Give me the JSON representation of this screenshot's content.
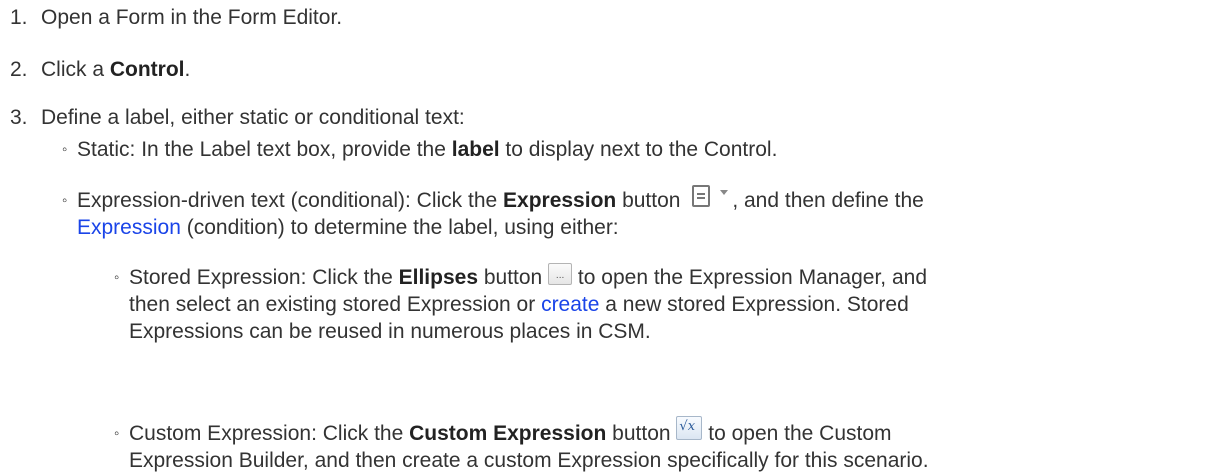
{
  "steps": [
    {
      "num": "1.",
      "text": "Open a Form in the Form Editor."
    },
    {
      "num": "2.",
      "pre": "Click a ",
      "bold": "Control",
      "post": "."
    },
    {
      "num": "3.",
      "text": "Define a label, either static or conditional text:"
    }
  ],
  "static_item": {
    "pre": "Static: In the Label text box, provide the ",
    "bold": "label",
    "post": " to display next to the Control."
  },
  "expression_item": {
    "pre": "Expression-driven text (conditional): Click the ",
    "bold": "Expression",
    "mid": " button",
    "post": ", and then define the",
    "link": "Expression",
    "post2": " (condition) to determine the label, using either:",
    "icon": "expression-document-dropdown-icon"
  },
  "stored_item": {
    "pre": "Stored Expression: Click the ",
    "bold": "Ellipses",
    "mid": " button",
    "post": " to open the Expression Manager, and",
    "line2_pre": "then select an existing stored Expression or ",
    "link": "create",
    "line2_post": " a new stored Expression. Stored",
    "line3": "Expressions can be reused in numerous places in CSM.",
    "icon": "ellipses-button-icon",
    "icon_text": "..."
  },
  "custom_item": {
    "pre": "Custom Expression: Click the ",
    "bold": "Custom Expression",
    "mid": " button",
    "post": " to open the Custom",
    "line2": "Expression Builder, and then create a custom Expression specifically for this scenario.",
    "icon": "custom-expression-fx-icon",
    "icon_text": "√x"
  },
  "bullet_char": "◦",
  "link_color": "#1a44e8"
}
